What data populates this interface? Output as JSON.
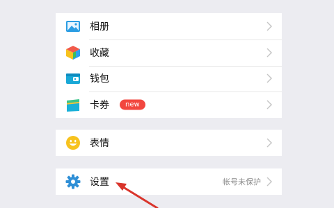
{
  "menu": {
    "items": [
      {
        "label": "相册",
        "icon": "photo-album-icon"
      },
      {
        "label": "收藏",
        "icon": "favorites-cube-icon"
      },
      {
        "label": "钱包",
        "icon": "wallet-icon"
      },
      {
        "label": "卡券",
        "icon": "card-coupon-icon",
        "badge": "new"
      }
    ],
    "stickers": {
      "label": "表情",
      "icon": "smiley-icon"
    },
    "settings": {
      "label": "设置",
      "icon": "gear-icon",
      "status": "帐号未保护"
    }
  },
  "colors": {
    "background": "#ececf1",
    "badge": "#f2473f",
    "arrow": "#d9342b",
    "settings_icon": "#2f8fd6"
  }
}
